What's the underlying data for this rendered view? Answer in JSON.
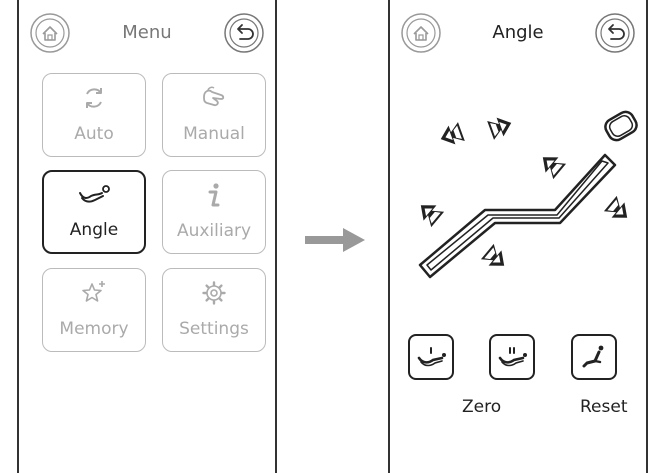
{
  "menu_screen": {
    "title": "Menu",
    "tiles": [
      {
        "label": "Auto",
        "icon": "cycle-arrows-icon",
        "state": "disabled"
      },
      {
        "label": "Manual",
        "icon": "hand-pointer-icon",
        "state": "disabled"
      },
      {
        "label": "Angle",
        "icon": "recline-angle-icon",
        "state": "selected"
      },
      {
        "label": "Auxiliary",
        "icon": "info-i-icon",
        "state": "disabled"
      },
      {
        "label": "Memory",
        "icon": "star-plus-icon",
        "state": "disabled"
      },
      {
        "label": "Settings",
        "icon": "gear-icon",
        "state": "disabled"
      }
    ]
  },
  "angle_screen": {
    "title": "Angle",
    "zero_label": "Zero",
    "reset_label": "Reset"
  },
  "colors": {
    "active": "#222222",
    "inactive": "#aaaaaa",
    "arrow": "#999999"
  }
}
